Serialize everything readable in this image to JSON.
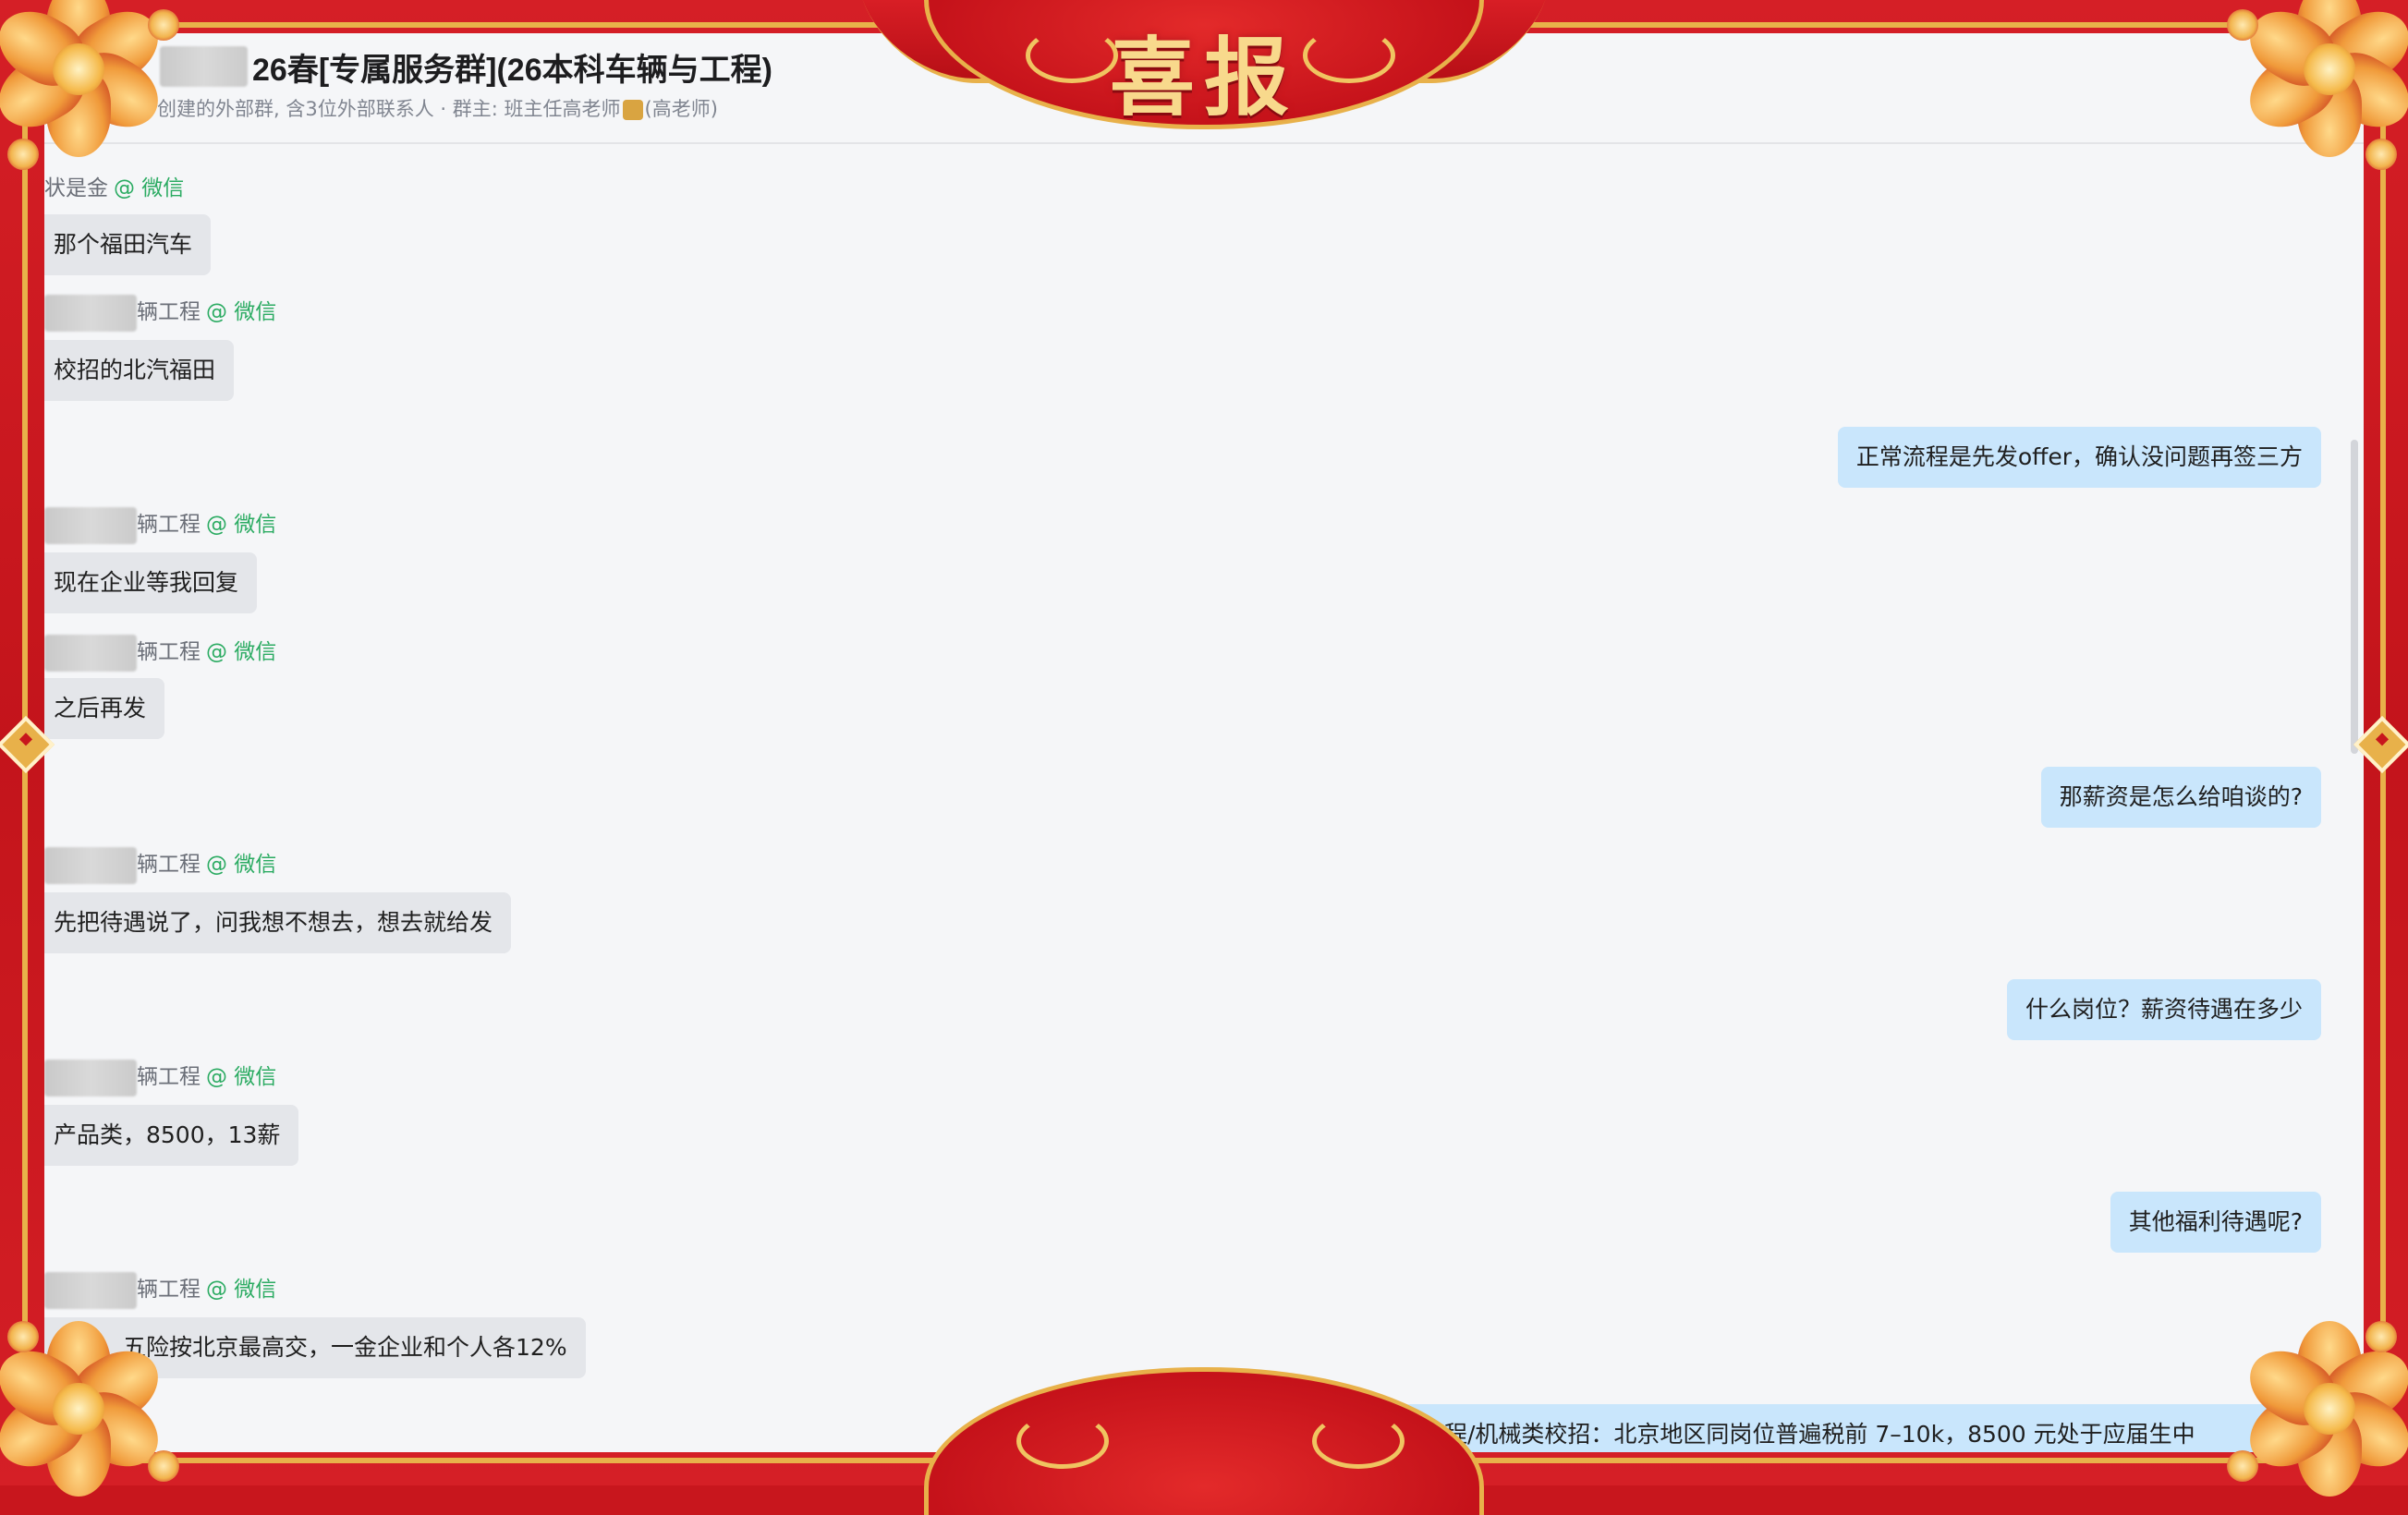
{
  "header": {
    "title": "26春[专属服务群](26本科车辆与工程)",
    "subtitle_prefix": "用户创建的外部群, 含3位外部联系人 · 群主: 班主任高老师",
    "subtitle_suffix": "(高老师)"
  },
  "banner": {
    "title": "喜报"
  },
  "tag_label": "@ 微信",
  "messages": [
    {
      "side": "left",
      "sender": "状是金",
      "text": "那个福田汽车"
    },
    {
      "side": "left",
      "sender": "辆工程",
      "text": "校招的北汽福田"
    },
    {
      "side": "right",
      "text": "正常流程是先发offer，确认没问题再签三方"
    },
    {
      "side": "left",
      "sender": "辆工程",
      "text": "现在企业等我回复"
    },
    {
      "side": "left",
      "sender": "辆工程",
      "text": "之后再发"
    },
    {
      "side": "right",
      "text": "那薪资是怎么给咱谈的?"
    },
    {
      "side": "left",
      "sender": "辆工程",
      "text": "先把待遇说了，问我想不想去，想去就给发"
    },
    {
      "side": "right",
      "text": "什么岗位？薪资待遇在多少"
    },
    {
      "side": "left",
      "sender": "辆工程",
      "text": "产品类，8500，13薪"
    },
    {
      "side": "right",
      "text": "其他福利待遇呢?"
    },
    {
      "side": "left",
      "sender": "辆工程",
      "text": "餐补，五险按北京最高交，一金企业和个人各12%"
    },
    {
      "side": "right",
      "text": "工程/机械类校招：北京地区同岗位普遍税前 7–10k，8500 元处于应届生中"
    }
  ],
  "colors": {
    "frame_red": "#c8161d",
    "frame_gold": "#e8b14a",
    "bubble_left": "#e4e6ea",
    "bubble_right": "#c9e6fc",
    "wechat_tag": "#2bab62"
  }
}
